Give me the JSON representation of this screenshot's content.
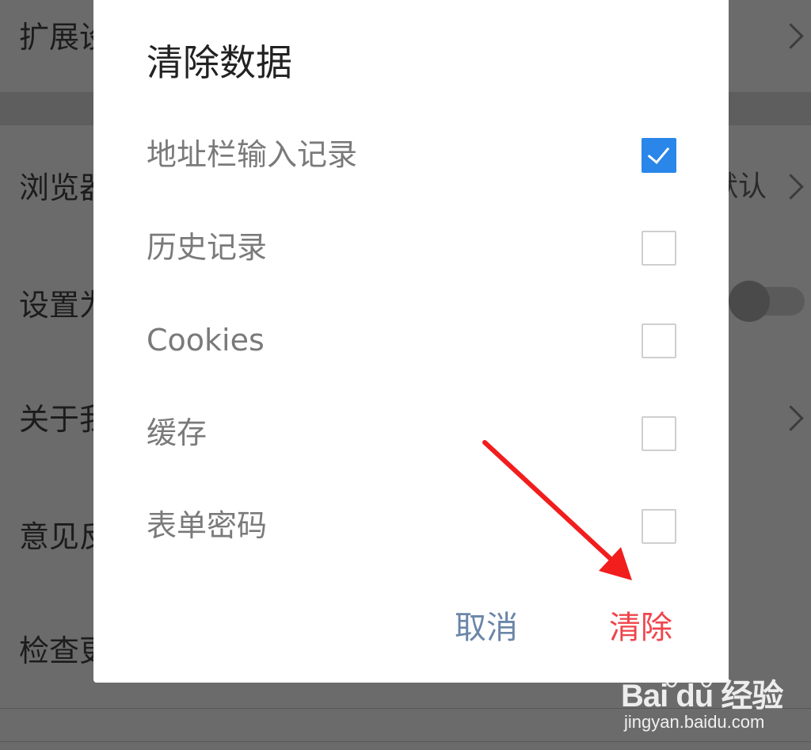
{
  "background": {
    "rows": [
      {
        "label": "扩展设置",
        "value": ""
      },
      {
        "label": "浏览器",
        "value": "默认"
      },
      {
        "label": "设置为",
        "value": ""
      },
      {
        "label": "关于我",
        "value": ""
      },
      {
        "label": "意见反",
        "value": ""
      },
      {
        "label": "检查更",
        "value": ""
      }
    ]
  },
  "dialog": {
    "title": "清除数据",
    "options": [
      {
        "label": "地址栏输入记录",
        "checked": true
      },
      {
        "label": "历史记录",
        "checked": false
      },
      {
        "label": "Cookies",
        "checked": false
      },
      {
        "label": "缓存",
        "checked": false
      },
      {
        "label": "表单密码",
        "checked": false
      }
    ],
    "cancel_label": "取消",
    "clear_label": "清除"
  },
  "watermark": {
    "logo_text": "Bai du 经验",
    "site": "jingyan.baidu.com"
  },
  "colors": {
    "overlay_bg": "#6b6b6b",
    "dialog_bg": "#ffffff",
    "checkbox_checked": "#2a86e8",
    "cancel_text": "#6b86a8",
    "clear_text": "#f0444b",
    "annotation_arrow": "#f21d1d"
  },
  "icons": {
    "row_chevron": "chevron-right-icon",
    "checked_mark": "check-icon",
    "annotation": "red-arrow-icon",
    "watermark": "baidu-paw-icon"
  }
}
